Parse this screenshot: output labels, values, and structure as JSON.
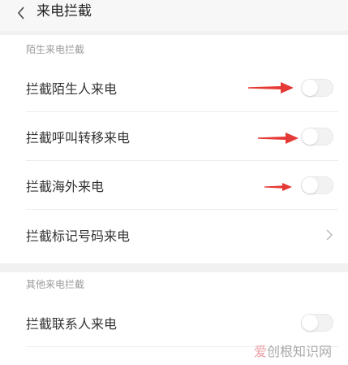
{
  "header": {
    "title": "来电拦截"
  },
  "section_stranger": {
    "title": "陌生来电拦截",
    "items": [
      {
        "label": "拦截陌生人来电",
        "toggle_on": false
      },
      {
        "label": "拦截呼叫转移来电",
        "toggle_on": false
      },
      {
        "label": "拦截海外来电",
        "toggle_on": false
      },
      {
        "label": "拦截标记号码来电"
      }
    ]
  },
  "section_other": {
    "title": "其他来电拦截",
    "items": [
      {
        "label": "拦截联系人来电",
        "toggle_on": false
      }
    ]
  },
  "watermark": {
    "accent": "爱",
    "rest": "创根知识网"
  },
  "colors": {
    "annotation_arrow": "#e53935",
    "toggle_off": "#f2f2f2",
    "background": "#f1f1f1"
  }
}
